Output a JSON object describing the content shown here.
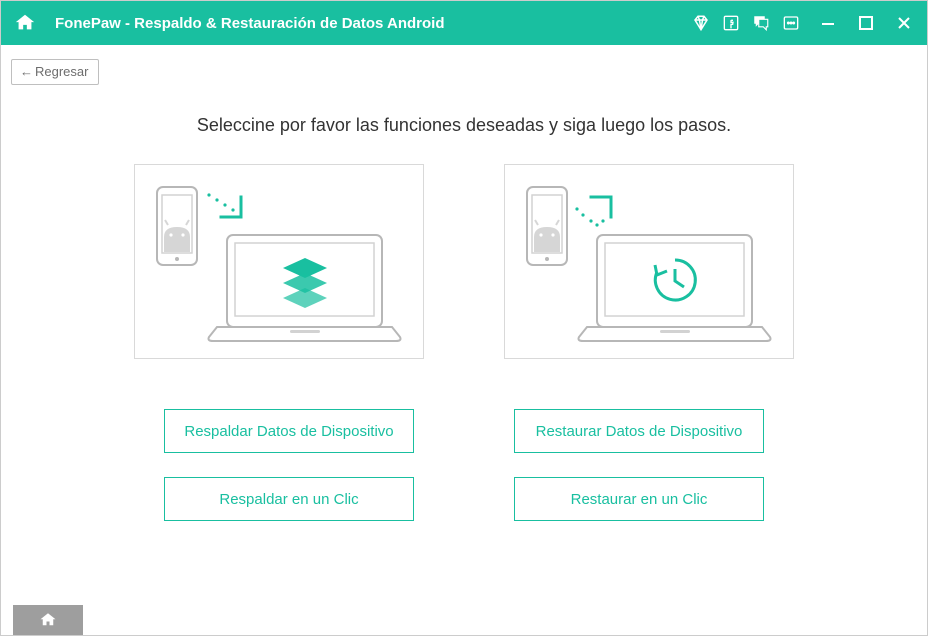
{
  "header": {
    "title": "FonePaw -  Respaldo & Restauración de Datos Android"
  },
  "nav": {
    "back_label": "Regresar"
  },
  "main": {
    "headline": "Seleccine por favor las funciones deseadas y siga luego los pasos."
  },
  "actions": {
    "backup_device": "Respaldar Datos de Dispositivo",
    "backup_one_click": "Respaldar en un Clic",
    "restore_device": "Restaurar Datos de Dispositivo",
    "restore_one_click": "Restaurar en un Clic"
  }
}
